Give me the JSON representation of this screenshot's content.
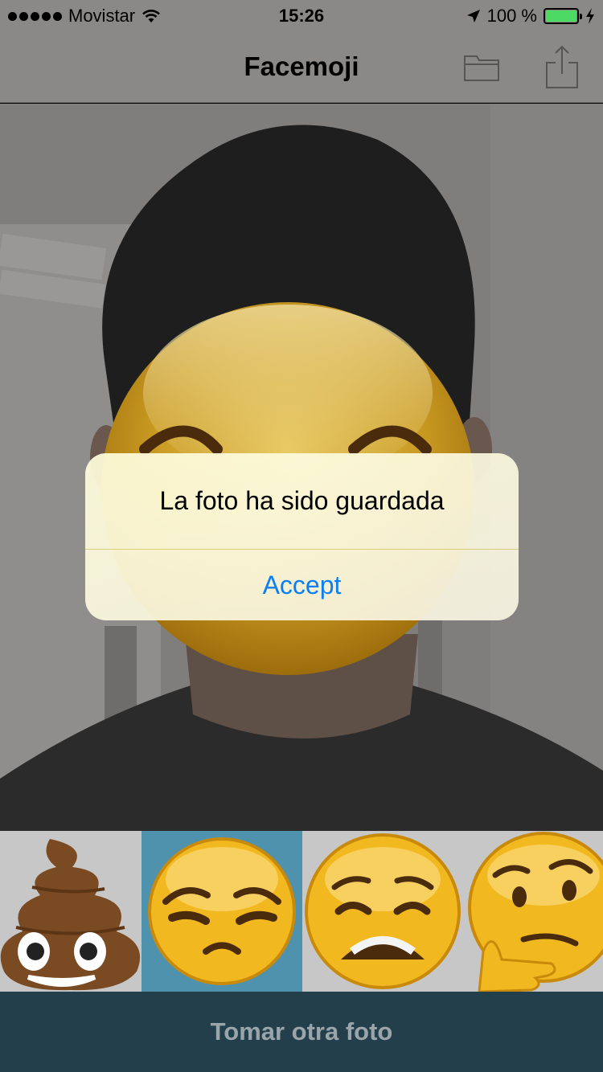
{
  "status_bar": {
    "carrier": "Movistar",
    "time": "15:26",
    "battery_percent": "100 %",
    "battery_level": 1.0
  },
  "nav": {
    "title": "Facemoji",
    "folder_icon": "folder-icon",
    "share_icon": "share-icon"
  },
  "alert": {
    "message": "La foto ha sido guardada",
    "button_label": "Accept"
  },
  "emoji_picker": {
    "items": [
      {
        "icon": "pile-of-poo-icon",
        "selected": false
      },
      {
        "icon": "unamused-face-icon",
        "selected": true
      },
      {
        "icon": "weary-face-icon",
        "selected": false
      },
      {
        "icon": "thinking-face-icon",
        "selected": false
      }
    ]
  },
  "bottom_button": {
    "label": "Tomar otra foto"
  },
  "colors": {
    "accent_blue": "#0a7ff5",
    "selected_cell": "#4f92ad",
    "bottom_bar": "#243f4c",
    "battery_green": "#4cd964"
  }
}
